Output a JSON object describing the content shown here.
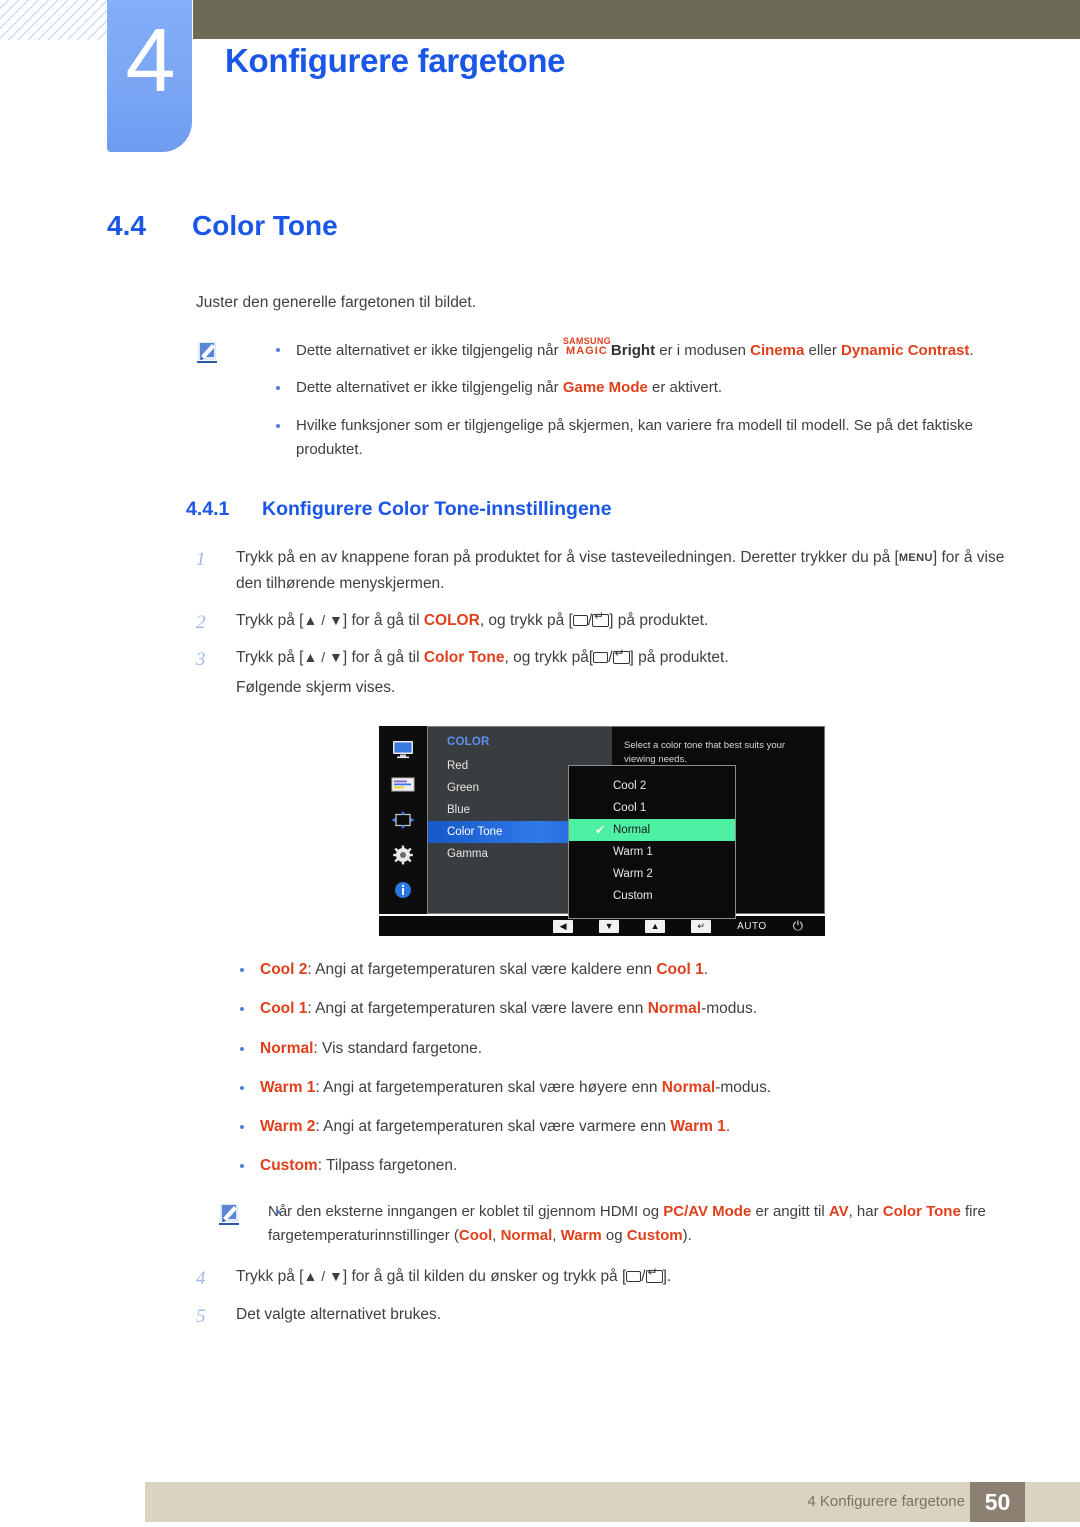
{
  "header": {
    "chapter_number": "4",
    "chapter_title": "Konfigurere fargetone"
  },
  "section": {
    "number": "4.4",
    "title": "Color Tone",
    "lead": "Juster den generelle fargetonen til bildet."
  },
  "note_top": {
    "icon": "note-pencil-icon",
    "bullets": [
      {
        "p1": "Dette alternativet er ikke tilgjengelig når ",
        "magic_top": "SAMSUNG",
        "magic_bottom": "MAGIC",
        "magic_suffix": "Bright",
        "p2": " er i modusen ",
        "hot1": "Cinema",
        "p3": " eller ",
        "hot2": "Dynamic Contrast",
        "p4": "."
      },
      {
        "p1": "Dette alternativet er ikke tilgjengelig når ",
        "hot1": "Game Mode",
        "p2": " er aktivert."
      },
      {
        "p1": "Hvilke funksjoner som er tilgjengelige på skjermen, kan variere fra modell til modell. Se på det faktiske produktet."
      }
    ]
  },
  "subsection": {
    "number": "4.4.1",
    "title": "Konfigurere Color Tone-innstillingene"
  },
  "steps": [
    {
      "n": "1",
      "a": "Trykk på en av knappene foran på produktet for å vise tasteveiledningen. Deretter trykker du på [",
      "kbd": "MENU",
      "b": "] for å vise den tilhørende menyskjermen."
    },
    {
      "n": "2",
      "a": "Trykk på [",
      "arrows": "▲ / ▼",
      "b": "] for å gå til ",
      "hot": "COLOR",
      "c": ", og trykk på [",
      "d": "] på produktet."
    },
    {
      "n": "3",
      "a": "Trykk på [",
      "arrows": "▲ / ▼",
      "b": "] for å gå til ",
      "hot": "Color Tone",
      "c": ", og trykk på[",
      "d": "] på produktet.",
      "extra": "Følgende skjerm vises."
    },
    {
      "n": "4",
      "a": "Trykk på [",
      "arrows": "▲ / ▼",
      "b": "] for å gå til kilden du ønsker og trykk på [",
      "d": "]."
    },
    {
      "n": "5",
      "a": "Det valgte alternativet brukes."
    }
  ],
  "osd": {
    "rail_icons": [
      "monitor-icon",
      "picture-settings-icon",
      "position-arrows-icon",
      "gear-icon",
      "info-icon"
    ],
    "menu_title": "COLOR",
    "menu_items": [
      {
        "label": "Red",
        "selected": false
      },
      {
        "label": "Green",
        "selected": false
      },
      {
        "label": "Blue",
        "selected": false
      },
      {
        "label": "Color Tone",
        "selected": true
      },
      {
        "label": "Gamma",
        "selected": false
      }
    ],
    "submenu_options": [
      {
        "label": "Cool 2",
        "checked": false
      },
      {
        "label": "Cool 1",
        "checked": false
      },
      {
        "label": "Normal",
        "checked": true
      },
      {
        "label": "Warm 1",
        "checked": false
      },
      {
        "label": "Warm 2",
        "checked": false
      },
      {
        "label": "Custom",
        "checked": false
      }
    ],
    "help_text": "Select a color tone that best suits your viewing needs.",
    "bottom_bar": {
      "left_button": "◀",
      "down_button": "▼",
      "up_button": "▲",
      "enter_button": "↵",
      "auto_label": "AUTO",
      "power_icon": "power-icon"
    },
    "colors": {
      "selected_row": "#2f7ae8",
      "checked_option": "#4ef0a4",
      "menu_title": "#5b8ff0"
    }
  },
  "options": [
    {
      "term": "Cool 2",
      "mid": ": Angi at fargetemperaturen skal være kaldere enn ",
      "hot2": "Cool 1",
      "end": "."
    },
    {
      "term": "Cool 1",
      "mid": ": Angi at fargetemperaturen skal være lavere enn ",
      "hot2": "Normal",
      "end": "-modus."
    },
    {
      "term": "Normal",
      "mid": ": Vis standard fargetone.",
      "hot2": "",
      "end": ""
    },
    {
      "term": "Warm 1",
      "mid": ": Angi at fargetemperaturen skal være høyere enn ",
      "hot2": "Normal",
      "end": "-modus."
    },
    {
      "term": "Warm 2",
      "mid": ": Angi at fargetemperaturen skal være varmere enn ",
      "hot2": "Warm 1",
      "end": "."
    },
    {
      "term": "Custom",
      "mid": ": Tilpass fargetonen.",
      "hot2": "",
      "end": ""
    }
  ],
  "note_bottom": {
    "icon": "note-pencil-icon",
    "p1": "Når den eksterne inngangen er koblet til gjennom HDMI og ",
    "hot1": "PC/AV Mode",
    "p2": " er angitt til ",
    "hot2": "AV",
    "p3": ", har ",
    "hot3": "Color Tone",
    "p4": " fire fargetemperaturinnstillinger (",
    "hot4": "Cool",
    "p5": ", ",
    "hot5": "Normal",
    "p6": ", ",
    "hot6": "Warm",
    "p7": " og ",
    "hot7": "Custom",
    "p8": ")."
  },
  "footer": {
    "text": "4 Konfigurere fargetone",
    "page": "50"
  },
  "colors": {
    "brand_blue": "#1a56e8",
    "accent_orange": "#e0401c",
    "olive": "#6d6a55",
    "tab_blue": "#7aa6f4",
    "footer_beige": "#d9d3c2",
    "footer_page_box": "#8c8072"
  }
}
